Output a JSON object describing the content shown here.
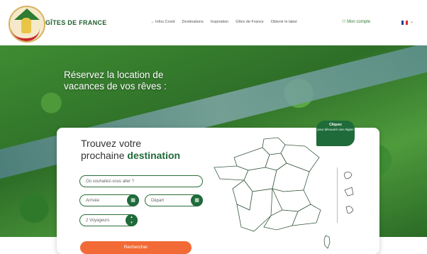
{
  "header": {
    "brand": "GÎTES DE FRANCE",
    "nav": [
      "→ Infos Covid",
      "Destinations",
      "Inspiration",
      "Gîtes de France",
      "Obtenir le label"
    ],
    "account": "Mon compte",
    "language_icon": "flag-fr-icon",
    "colors": {
      "brand_green": "#1f5e2c"
    }
  },
  "hero": {
    "title": "Réservez la location de vacances de vos rêves :"
  },
  "search": {
    "title_line1": "Trouvez votre",
    "title_line2_prefix": "prochaine",
    "title_line2_highlight": "destination",
    "destination_placeholder": "Où souhaitez-vous aller ?",
    "arrival_placeholder": "Arrivée",
    "departure_placeholder": "Départ",
    "travellers_value": "2 Voyageurs",
    "submit_label": "Rechercher",
    "colors": {
      "accent": "#f26a36",
      "green": "#1f6b3a"
    }
  },
  "map": {
    "bubble_title": "Cliquez",
    "bubble_text": "pour découvrir une région"
  }
}
